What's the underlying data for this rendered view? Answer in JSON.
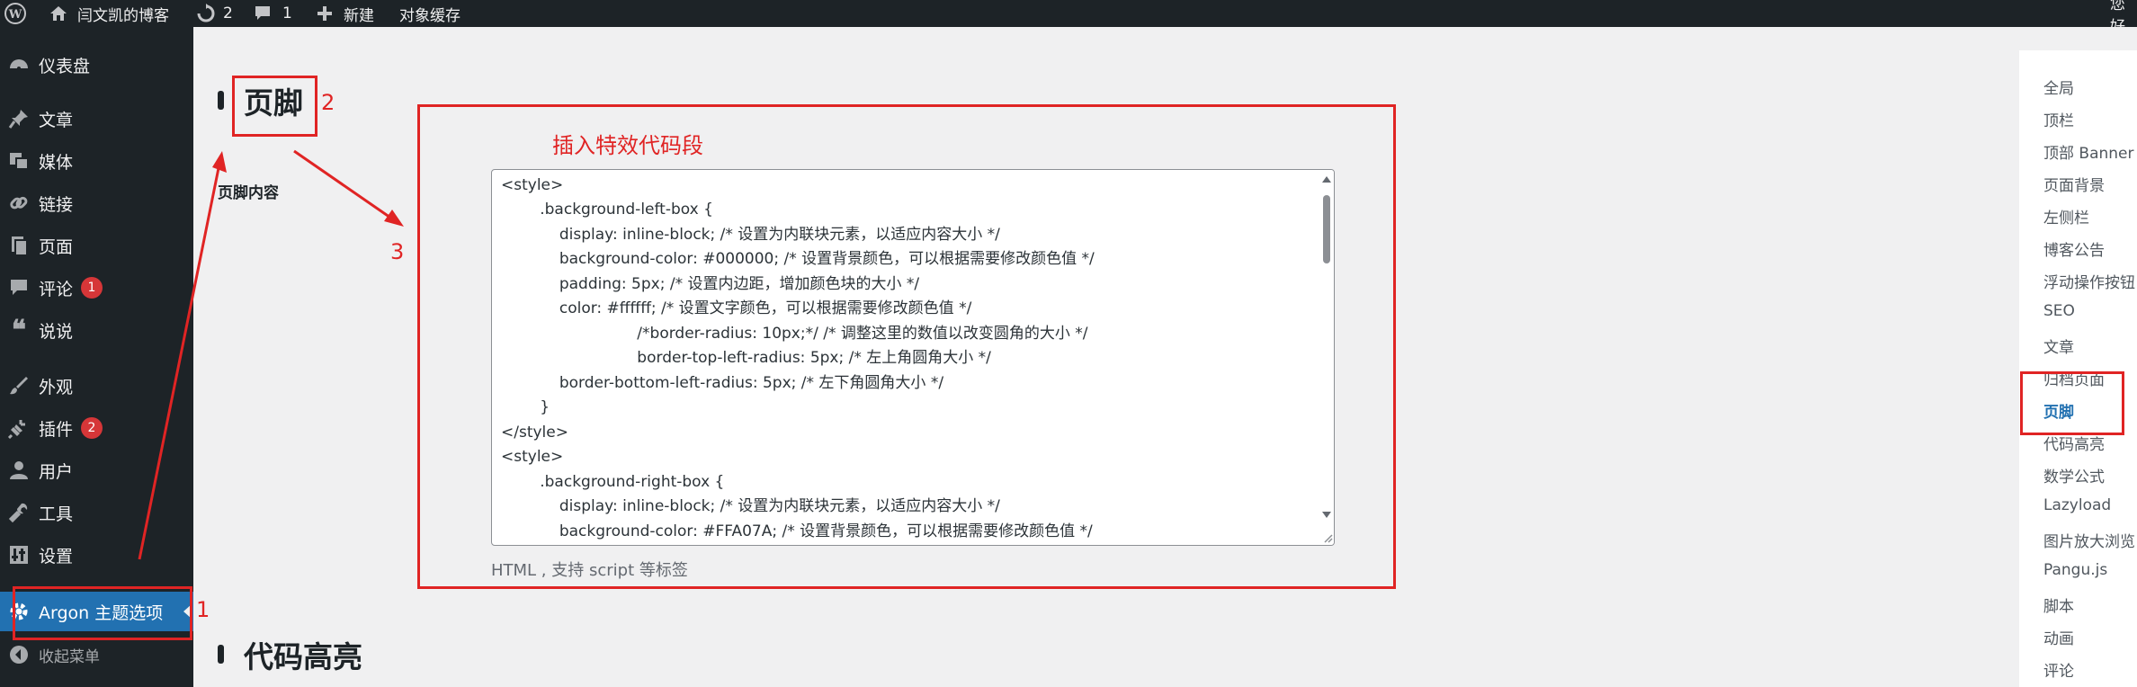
{
  "adminbar": {
    "site_name": "闫文凯的博客",
    "updates_count": "2",
    "comments_count": "1",
    "new_label": "新建",
    "object_cache_label": "对象缓存",
    "right_text": "您好"
  },
  "sidebar": {
    "items": [
      {
        "label": "仪表盘",
        "icon": "dashboard-icon"
      },
      {
        "label": "文章",
        "icon": "pin-icon"
      },
      {
        "label": "媒体",
        "icon": "media-icon"
      },
      {
        "label": "链接",
        "icon": "link-icon"
      },
      {
        "label": "页面",
        "icon": "page-icon"
      },
      {
        "label": "评论",
        "icon": "comment-icon",
        "badge": "1"
      },
      {
        "label": "说说",
        "icon": "quote-icon"
      },
      {
        "label": "外观",
        "icon": "appearance-icon"
      },
      {
        "label": "插件",
        "icon": "plugin-icon",
        "badge": "2"
      },
      {
        "label": "用户",
        "icon": "user-icon"
      },
      {
        "label": "工具",
        "icon": "wrench-icon"
      },
      {
        "label": "设置",
        "icon": "settings-icon"
      },
      {
        "label": "Argon 主题选项",
        "icon": "gear-icon",
        "active": true
      },
      {
        "label": "收起菜单",
        "icon": "collapse-icon"
      }
    ]
  },
  "main": {
    "footer_section_title": "页脚",
    "footer_content_label": "页脚内容",
    "code_lines": [
      "<style>",
      "        .background-left-box {",
      "            display: inline-block; /* 设置为内联块元素，以适应内容大小 */",
      "            background-color: #000000; /* 设置背景颜色，可以根据需要修改颜色值 */",
      "            padding: 5px; /* 设置内边距，增加颜色块的大小 */",
      "            color: #ffffff; /* 设置文字颜色，可以根据需要修改颜色值 */",
      "                            /*border-radius: 10px;*/ /* 调整这里的数值以改变圆角的大小 */",
      "                            border-top-left-radius: 5px; /* 左上角圆角大小 */",
      "            border-bottom-left-radius: 5px; /* 左下角圆角大小 */",
      "        }",
      "</style>",
      "<style>",
      "        .background-right-box {",
      "            display: inline-block; /* 设置为内联块元素，以适应内容大小 */",
      "            background-color: #FFA07A; /* 设置背景颜色，可以根据需要修改颜色值 */"
    ],
    "hint": "HTML , 支持 script 等标签",
    "code_section_title": "代码高亮"
  },
  "rightnav": {
    "items": [
      {
        "label": "全局"
      },
      {
        "label": "顶栏"
      },
      {
        "label": "顶部 Banner"
      },
      {
        "label": "页面背景"
      },
      {
        "label": "左侧栏"
      },
      {
        "label": "博客公告"
      },
      {
        "label": "浮动操作按钮"
      },
      {
        "label": "SEO"
      },
      {
        "label": "文章"
      },
      {
        "label": "归档页面"
      },
      {
        "label": "页脚",
        "current": true
      },
      {
        "label": "代码高亮"
      },
      {
        "label": "数学公式"
      },
      {
        "label": "Lazyload"
      },
      {
        "label": "图片放大浏览"
      },
      {
        "label": "Pangu.js"
      },
      {
        "label": "脚本"
      },
      {
        "label": "动画"
      },
      {
        "label": "评论"
      }
    ]
  },
  "annotations": {
    "num1": "1",
    "num2": "2",
    "num3": "3",
    "insert_label": "插入特效代码段"
  },
  "colors": {
    "admin_dark": "#1d2327",
    "active_blue": "#2271b1",
    "annotation_red": "#e02424"
  }
}
